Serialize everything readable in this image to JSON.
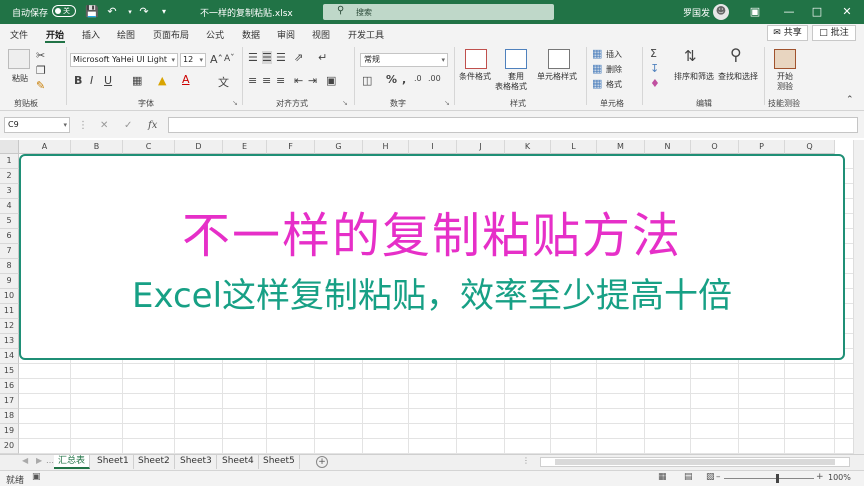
{
  "titlebar": {
    "autosave_label": "自动保存",
    "autosave_state": "关",
    "filename": "不一样的复制粘贴.xlsx",
    "search_placeholder": "搜索",
    "username": "罗国发"
  },
  "menu": {
    "tabs": [
      "文件",
      "开始",
      "插入",
      "绘图",
      "页面布局",
      "公式",
      "数据",
      "审阅",
      "视图",
      "开发工具"
    ],
    "active_tab": "开始",
    "share": "共享",
    "comment": "批注"
  },
  "ribbon": {
    "clipboard": {
      "paste": "粘贴",
      "label": "剪贴板"
    },
    "font": {
      "family": "Microsoft YaHei UI Light",
      "size": "12",
      "label": "字体"
    },
    "alignment": {
      "label": "对齐方式"
    },
    "number": {
      "format": "常规",
      "label": "数字"
    },
    "styles": {
      "conditional": "条件格式",
      "table_format_1": "套用",
      "table_format_2": "表格格式",
      "cell_styles": "单元格样式",
      "label": "样式"
    },
    "cells": {
      "insert": "插入",
      "delete": "删除",
      "format": "格式",
      "label": "单元格"
    },
    "editing": {
      "sort_filter": "排序和筛选",
      "find_select": "查找和选择",
      "label": "编辑"
    },
    "skills": {
      "start_1": "开始",
      "start_2": "测验",
      "label": "技能测验"
    }
  },
  "formula": {
    "name_box": "C9",
    "fx": "fx"
  },
  "grid": {
    "columns": [
      "A",
      "B",
      "C",
      "D",
      "E",
      "F",
      "G",
      "H",
      "I",
      "J",
      "K",
      "L",
      "M",
      "N",
      "O",
      "P",
      "Q"
    ],
    "rows": [
      "1",
      "2",
      "3",
      "4",
      "5",
      "6",
      "7",
      "8",
      "9",
      "10",
      "11",
      "12",
      "13",
      "14",
      "15",
      "16",
      "17",
      "18",
      "19",
      "20"
    ]
  },
  "textbox": {
    "headline": "不一样的复制粘贴方法",
    "subline": "Excel这样复制粘贴，效率至少提高十倍",
    "headline_color": "#e62fc8",
    "subline_color": "#17a085",
    "border_color": "#1f8f76"
  },
  "sheets": {
    "tabs": [
      "汇总表",
      "Sheet1",
      "Sheet2",
      "Sheet3",
      "Sheet4",
      "Sheet5"
    ],
    "active": "汇总表"
  },
  "status": {
    "ready": "就绪",
    "zoom": "100%"
  },
  "colors": {
    "brand": "#217346"
  }
}
